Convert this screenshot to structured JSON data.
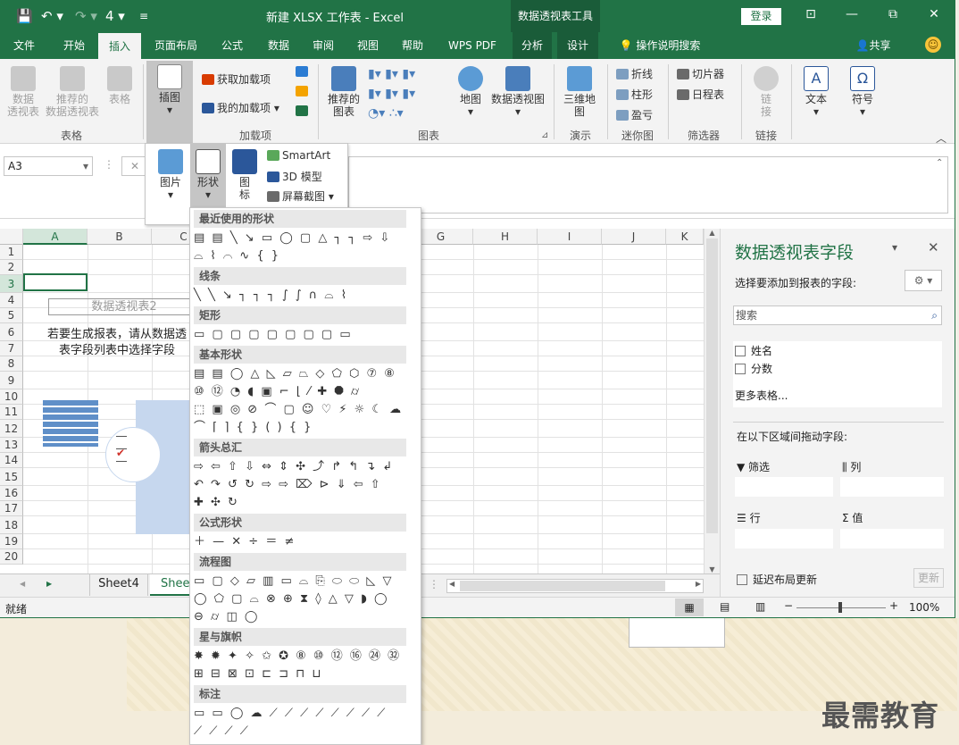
{
  "window": {
    "title": "新建 XLSX 工作表 - Excel",
    "context_title": "数据透视表工具",
    "login": "登录",
    "min": "—",
    "restore": "⧉",
    "close": "✕",
    "ribbon_opts": "⊡"
  },
  "qat": {
    "save": "💾",
    "undo": "↶ ▾",
    "redo": "↷ ▾",
    "touch": "4 ▾",
    "more": "≡"
  },
  "tabs": [
    "文件",
    "开始",
    "插入",
    "页面布局",
    "公式",
    "数据",
    "审阅",
    "视图",
    "帮助",
    "WPS PDF",
    "分析",
    "设计",
    "操作说明搜索"
  ],
  "share": "共享",
  "ribbon": {
    "pivot": "数据\n透视表",
    "rec_pivot": "推荐的\n数据透视表",
    "table": "表格",
    "g_table": "表格",
    "illus": "插图",
    "get_addins": "获取加载项",
    "my_addins": "我的加载项",
    "g_addins": "加载项",
    "rec_charts": "推荐的\n图表",
    "map": "地图",
    "pivot_chart": "数据透视图",
    "g_charts": "图表",
    "map3d": "三维地\n图",
    "g_tours": "演示",
    "line": "折线",
    "column": "柱形",
    "winloss": "盈亏",
    "g_spark": "迷你图",
    "slicer": "切片器",
    "timeline": "日程表",
    "g_filter": "筛选器",
    "link": "链\n接",
    "g_link": "链接",
    "text": "文本",
    "symbol": "符号"
  },
  "illus_popup": {
    "picture": "图片",
    "shapes": "形状",
    "icons": "图\n标",
    "smartart": "SmartArt",
    "model3d": "3D 模型",
    "screenshot": "屏幕截图"
  },
  "namebox": "A3",
  "grid": {
    "columns": [
      "A",
      "B",
      "C",
      "D",
      "E",
      "F",
      "G",
      "H",
      "I",
      "J",
      "K"
    ],
    "rows": [
      "1",
      "2",
      "3",
      "4",
      "5",
      "6",
      "7",
      "8",
      "9",
      "10",
      "11",
      "12",
      "13",
      "14",
      "15",
      "16",
      "17",
      "18",
      "19",
      "20"
    ],
    "pivot_name": "数据透视表2",
    "instr1": "若要生成报表，请从数据透",
    "instr2": "表字段列表中选择字段"
  },
  "sheet_tabs": [
    "Sheet4",
    "Sheet"
  ],
  "status": {
    "ready": "就绪",
    "zoom": "100%"
  },
  "pane": {
    "title": "数据透视表字段",
    "choose": "选择要添加到报表的字段:",
    "search_placeholder": "搜索",
    "fields": [
      "姓名",
      "分数"
    ],
    "more": "更多表格...",
    "drag": "在以下区域间拖动字段:",
    "filter": "筛选",
    "cols": "列",
    "rows": "行",
    "values": "值",
    "defer": "延迟布局更新",
    "update": "更新"
  },
  "shapes_menu": {
    "cats": [
      "最近使用的形状",
      "线条",
      "矩形",
      "基本形状",
      "箭头总汇",
      "公式形状",
      "流程图",
      "星与旗帜",
      "标注"
    ],
    "rows": [
      "▤ ▤ ╲ ↘ ▭ ◯ ▢ △ ┐ ┐ ⇨ ⇩",
      "⌓ ⌇ ⌒ ∿ { }",
      "╲ ╲ ↘ ┐ ┐ ┐ ∫ ∫ ∩ ⌓ ⌇",
      "▭ ▢ ▢ ▢ ▢ ▢ ▢ ▢ ▭",
      "▤ ▤ ◯ △ ◺ ▱ ⏢ ◇ ⬠ ⬡ ⑦ ⑧",
      "⑩ ⑫ ◔ ◖ ▣ ⌐ ⌊ ⁄ ✚ ⯃ ⌭",
      "⬚ ▣ ◎ ⊘ ⌒ ▢ ☺ ♡ ⚡ ☼ ☾ ☁",
      "⌒ ⌈ ⌉ { } ( ) { }",
      "⇨ ⇦ ⇧ ⇩ ⇔ ⇕ ✣ ⤴ ↱ ↰ ↴ ↲",
      "↶ ↷ ↺ ↻ ⇨ ⇨ ⌦ ⊳ ⇓ ⇦ ⇧",
      "✚ ✣ ↻",
      "＋ — ✕ ÷ ＝ ≠",
      "▭ ▢ ◇ ▱ ▥ ▭ ⌓ ⎘ ⬭ ⬭ ◺ ▽",
      "◯ ⬠ ▢ ⌓ ⊗ ⊕ ⧗ ◊ △ ▽ ◗ ◯",
      "⊖ ⌭ ◫ ◯",
      "✸ ✹ ✦ ✧ ✩ ✪ ⑧ ⑩ ⑫ ⑯ ㉔ ㉜",
      "⊞ ⊟ ⊠ ⊡ ⊏ ⊐ ⊓ ⊔",
      "▭ ▭ ◯ ☁ ⟋ ⟋ ⟋ ⟋ ⟋ ⟋ ⟋ ⟋",
      "⟋ ⟋ ⟋ ⟋"
    ]
  },
  "watermark": "最需教育",
  "colors": {
    "excel_green": "#217346"
  }
}
